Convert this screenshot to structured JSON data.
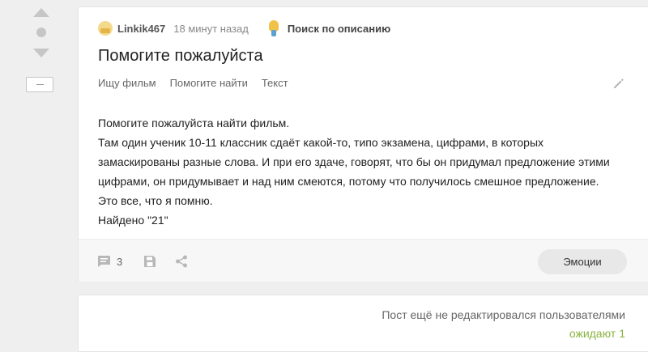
{
  "post": {
    "author": "Linkik467",
    "time": "18 минут назад",
    "community": "Поиск по описанию",
    "title": "Помогите пожалуйста",
    "tags": [
      "Ищу фильм",
      "Помогите найти",
      "Текст"
    ],
    "body": [
      "Помогите пожалуйста найти фильм.",
      "Там один ученик 10-11 классник сдаёт какой-то, типо экзамена, цифрами, в которых замаскированы разные слова. И при его здаче, говорят, что бы он придумал предложение этими цифрами, он придумывает и над ним смеются, потому что получилось смешное предложение.",
      "Это все, что я помню.",
      "Найдено \"21\""
    ],
    "comments_count": "3",
    "emotions_label": "Эмоции"
  },
  "edits": {
    "status": "Пост ещё не редактировался пользователями",
    "waiting_label": "ожидают",
    "waiting_count": "1"
  },
  "icons": {
    "vote_up": "arrow-up-icon",
    "vote_down": "arrow-down-icon",
    "edit": "pencil-icon",
    "comments": "comment-icon",
    "save": "save-icon",
    "share": "share-icon"
  },
  "colors": {
    "accent_green": "#8ab33f",
    "icon_gray": "#c6c6c6"
  }
}
